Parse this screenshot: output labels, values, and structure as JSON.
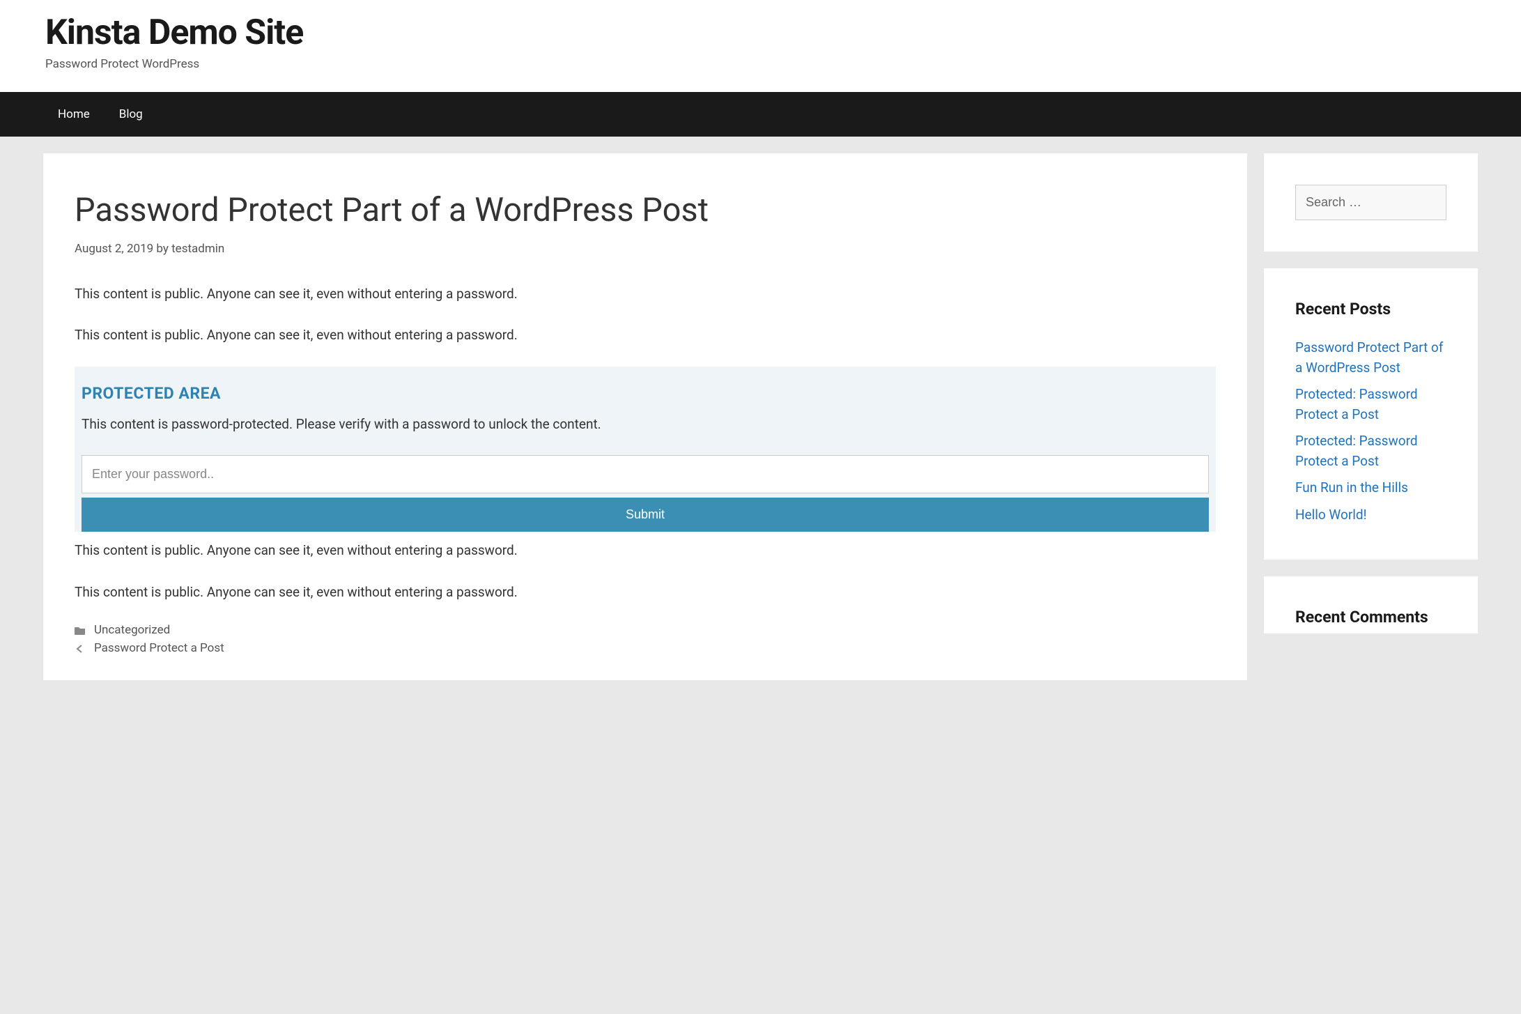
{
  "header": {
    "title": "Kinsta Demo Site",
    "tagline": "Password Protect WordPress"
  },
  "nav": {
    "items": [
      {
        "label": "Home"
      },
      {
        "label": "Blog"
      }
    ]
  },
  "post": {
    "title": "Password Protect Part of a WordPress Post",
    "date": "August 2, 2019",
    "by_label": "by",
    "author": "testadmin",
    "paragraphs_before": [
      "This content is public. Anyone can see it, even without entering a password.",
      "This content is public. Anyone can see it, even without entering a password."
    ],
    "protected": {
      "heading": "PROTECTED AREA",
      "description": "This content is password-protected. Please verify with a password to unlock the content.",
      "placeholder": "Enter your password..",
      "submit_label": "Submit"
    },
    "paragraphs_after": [
      "This content is public. Anyone can see it, even without entering a password.",
      "This content is public. Anyone can see it, even without entering a password."
    ],
    "footer": {
      "category": "Uncategorized",
      "prev_post": "Password Protect a Post"
    }
  },
  "sidebar": {
    "search": {
      "placeholder": "Search …"
    },
    "recent_posts": {
      "title": "Recent Posts",
      "items": [
        "Password Protect Part of a WordPress Post",
        "Protected: Password Protect a Post",
        "Protected: Password Protect a Post",
        "Fun Run in the Hills",
        "Hello World!"
      ]
    },
    "recent_comments": {
      "title": "Recent Comments"
    }
  }
}
